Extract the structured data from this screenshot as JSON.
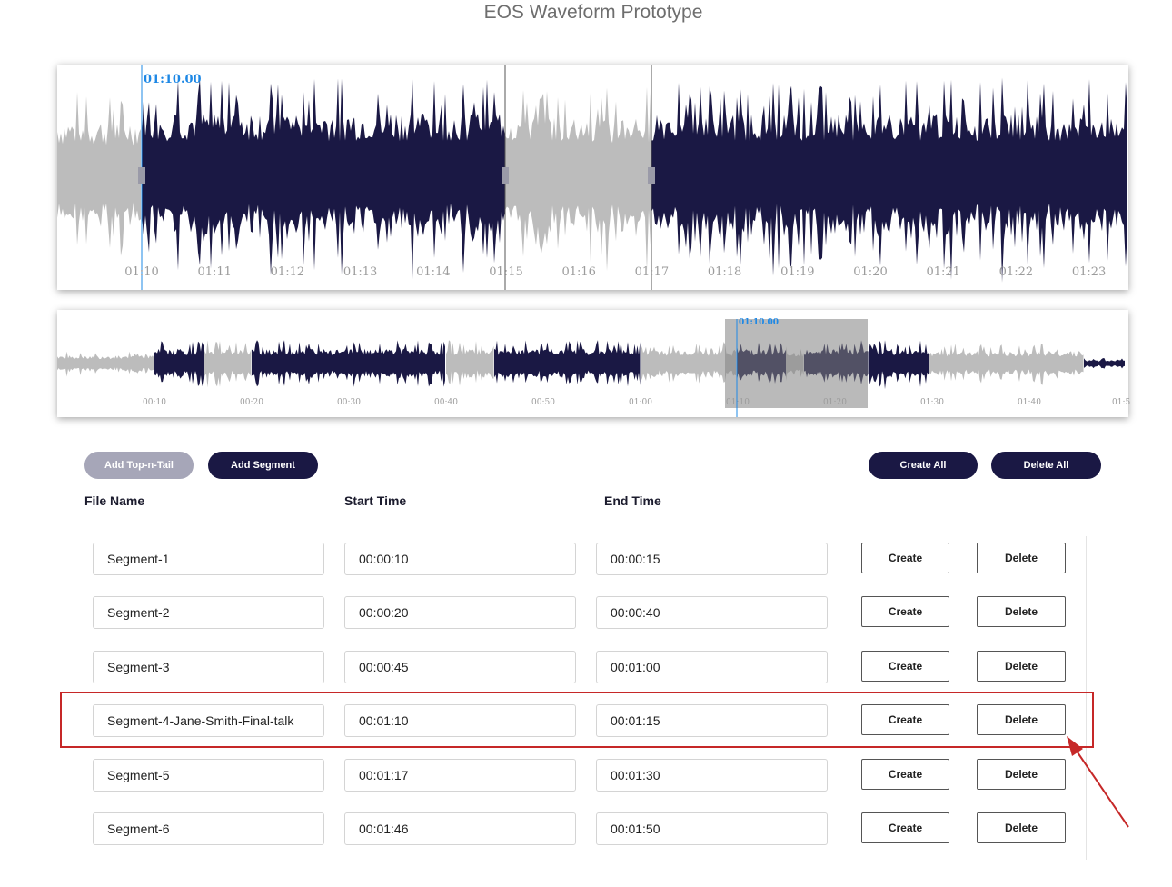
{
  "header": {
    "title": "EOS Waveform Prototype"
  },
  "colors": {
    "selected_wave": "#1a1844",
    "unselected_wave": "#bcbcbc",
    "playhead": "#1e88e5",
    "accent_button": "#1a1844",
    "disabled_button": "#a6a6b8",
    "highlight": "#c62828"
  },
  "waveform": {
    "playhead_label": "01:10.00",
    "tick_labels": [
      "01:10",
      "01:11",
      "01:12",
      "01:13",
      "01:14",
      "01:15",
      "01:16",
      "01:17",
      "01:18",
      "01:19",
      "01:20",
      "01:21",
      "01:22",
      "01:23"
    ],
    "segment_markers": [
      "01:10",
      "01:15",
      "01:17"
    ]
  },
  "overview": {
    "playhead_label": "01:10.00",
    "tick_labels": [
      "00:10",
      "00:20",
      "00:30",
      "00:40",
      "00:50",
      "01:00",
      "01:10",
      "01:20",
      "01:30",
      "01:40",
      "01:5"
    ],
    "viewport_range": [
      "01:09",
      "01:24"
    ]
  },
  "toolbar": {
    "add_top_tail": "Add Top-n-Tail",
    "add_segment": "Add Segment",
    "create_all": "Create All",
    "delete_all": "Delete All"
  },
  "table": {
    "headers": {
      "file_name": "File Name",
      "start_time": "Start Time",
      "end_time": "End Time"
    },
    "create_label": "Create",
    "delete_label": "Delete",
    "rows": [
      {
        "name": "Segment-1",
        "start": "00:00:10",
        "end": "00:00:15"
      },
      {
        "name": "Segment-2",
        "start": "00:00:20",
        "end": "00:00:40"
      },
      {
        "name": "Segment-3",
        "start": "00:00:45",
        "end": "00:01:00"
      },
      {
        "name": "Segment-4-Jane-Smith-Final-talk",
        "start": "00:01:10",
        "end": "00:01:15",
        "highlighted": true
      },
      {
        "name": "Segment-5",
        "start": "00:01:17",
        "end": "00:01:30"
      },
      {
        "name": "Segment-6",
        "start": "00:01:46",
        "end": "00:01:50"
      }
    ]
  },
  "icons": {
    "annotation": "red-arrow-icon"
  }
}
